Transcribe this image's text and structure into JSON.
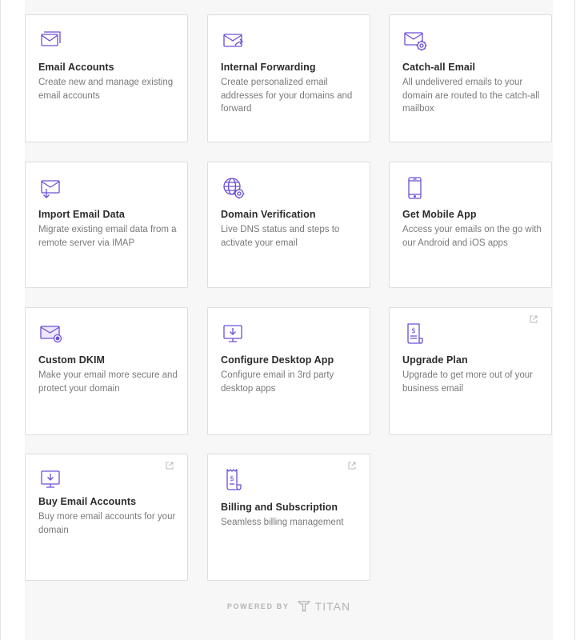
{
  "colors": {
    "accent": "#6b4fd6",
    "card_bg": "#ffffff",
    "panel_bg": "#f7f7f8",
    "title": "#2b2b2b",
    "desc": "#7a7a7a"
  },
  "cards": [
    {
      "icon": "email-accounts-icon",
      "title": "Email Accounts",
      "desc": "Create new and manage existing email accounts",
      "external": false
    },
    {
      "icon": "internal-forwarding-icon",
      "title": "Internal Forwarding",
      "desc": "Create personalized email addresses for your domains and forward",
      "external": false
    },
    {
      "icon": "catch-all-email-icon",
      "title": "Catch-all Email",
      "desc": "All undelivered emails to your domain are routed to the catch-all mailbox",
      "external": false
    },
    {
      "icon": "import-email-data-icon",
      "title": "Import Email Data",
      "desc": "Migrate existing email data from a remote server via IMAP",
      "external": false
    },
    {
      "icon": "domain-verification-icon",
      "title": "Domain Verification",
      "desc": "Live DNS status and steps to activate your email",
      "external": false
    },
    {
      "icon": "mobile-app-icon",
      "title": "Get Mobile App",
      "desc": "Access your emails on the go with our Android and iOS apps",
      "external": false
    },
    {
      "icon": "custom-dkim-icon",
      "title": "Custom DKIM",
      "desc": "Make your email more secure and protect your domain",
      "external": false
    },
    {
      "icon": "desktop-app-icon",
      "title": "Configure Desktop App",
      "desc": "Configure email in 3rd party desktop apps",
      "external": false
    },
    {
      "icon": "upgrade-plan-icon",
      "title": "Upgrade Plan",
      "desc": "Upgrade to get more out of your business email",
      "external": true
    },
    {
      "icon": "buy-email-accounts-icon",
      "title": "Buy Email Accounts",
      "desc": "Buy more email accounts for your domain",
      "external": true
    },
    {
      "icon": "billing-icon",
      "title": "Billing and Subscription",
      "desc": "Seamless billing management",
      "external": true
    }
  ],
  "footer": {
    "powered_by": "POWERED BY",
    "brand": "TITAN"
  }
}
